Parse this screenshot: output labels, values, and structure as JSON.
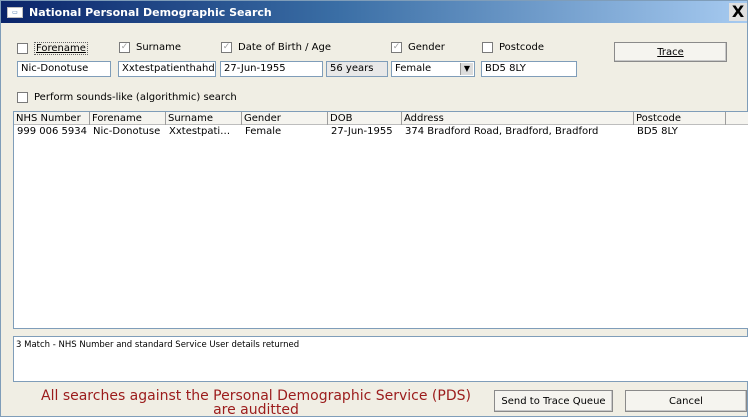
{
  "window": {
    "title": "National Personal Demographic Search",
    "close_glyph": "X"
  },
  "criteria": {
    "forename": {
      "label": "Forename",
      "checked": false,
      "value": "Nic-Donotuse"
    },
    "surname": {
      "label": "Surname",
      "checked": true,
      "value": "Xxtestpatienthahd"
    },
    "dob": {
      "label": "Date of Birth / Age",
      "checked": true,
      "value": "27-Jun-1955",
      "age": "56 years"
    },
    "gender": {
      "label": "Gender",
      "checked": true,
      "value": "Female"
    },
    "postcode": {
      "label": "Postcode",
      "checked": false,
      "value": "BD5 8LY"
    },
    "soundslike": {
      "label": "Perform sounds-like (algorithmic) search",
      "checked": false
    }
  },
  "buttons": {
    "trace": "Trace",
    "send": "Send to Trace Queue",
    "cancel": "Cancel"
  },
  "results": {
    "columns": [
      "NHS Number",
      "Forename",
      "Surname",
      "Gender",
      "DOB",
      "Address",
      "Postcode"
    ],
    "rows": [
      [
        "999 006 5934",
        "Nic-Donotuse",
        "Xxtestpati…",
        "Female",
        "27-Jun-1955",
        "374 Bradford Road, Bradford, Bradford",
        "BD5 8LY"
      ]
    ]
  },
  "status_text": "3 Match - NHS Number and standard Service User details returned",
  "banner": {
    "line1": "All searches against the Personal Demographic Service (PDS)",
    "line2": "are auditted"
  },
  "icons": {
    "app": "app-icon",
    "check": "✓",
    "dropdown": "▼"
  }
}
